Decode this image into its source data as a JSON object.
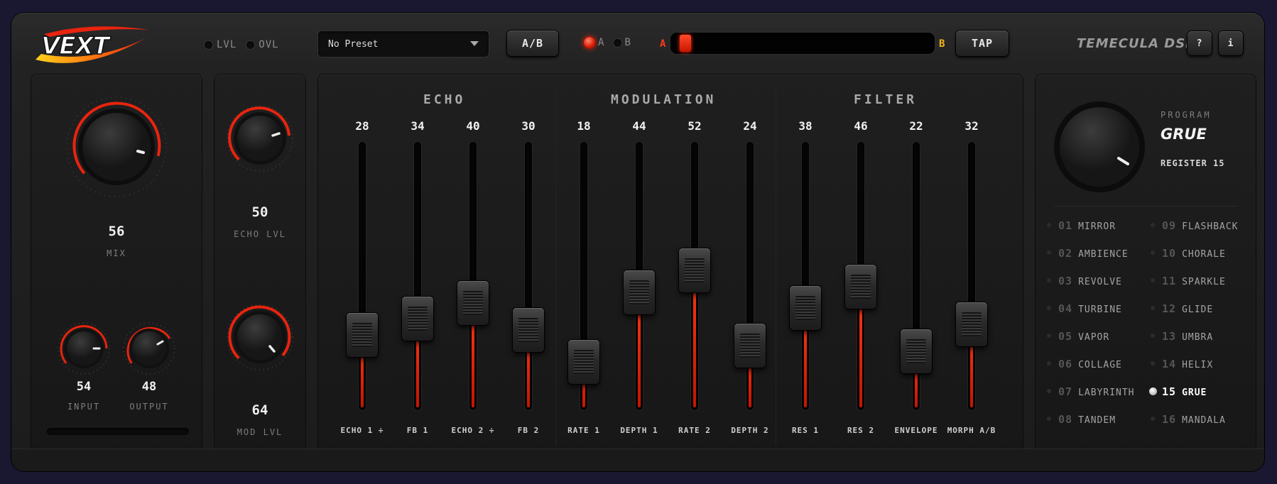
{
  "header": {
    "meter_lvl": "LVL",
    "meter_ovl": "OVL",
    "preset": "No Preset",
    "ab_button": "A/B",
    "ab_a": "A",
    "ab_b": "B",
    "morph_a": "A",
    "morph_b": "B",
    "morph_position": 0.02,
    "tap_button": "TAP",
    "brand": "TEMECULA DSP",
    "help_button": "?",
    "info_button": "i",
    "logo_text": "VEXT"
  },
  "left_panel": {
    "mix_value": "56",
    "mix_label": "MIX",
    "input_value": "54",
    "input_label": "INPUT",
    "output_value": "48",
    "output_label": "OUTPUT"
  },
  "level_panel": {
    "echo_value": "50",
    "echo_label": "ECHO LVL",
    "mod_value": "64",
    "mod_label": "MOD LVL"
  },
  "sections": {
    "echo": "ECHO",
    "modulation": "MODULATION",
    "filter": "FILTER"
  },
  "faders": [
    {
      "label": "ECHO 1 ÷",
      "value": 28
    },
    {
      "label": "FB 1",
      "value": 34
    },
    {
      "label": "ECHO 2 ÷",
      "value": 40
    },
    {
      "label": "FB 2",
      "value": 30
    },
    {
      "label": "RATE 1",
      "value": 18
    },
    {
      "label": "DEPTH 1",
      "value": 44
    },
    {
      "label": "RATE 2",
      "value": 52
    },
    {
      "label": "DEPTH 2",
      "value": 24
    },
    {
      "label": "RES 1",
      "value": 38
    },
    {
      "label": "RES 2",
      "value": 46
    },
    {
      "label": "ENVELOPE",
      "value": 22
    },
    {
      "label": "MORPH A/B",
      "value": 32
    }
  ],
  "program": {
    "label": "PROGRAM",
    "name": "GRUE",
    "register": "REGISTER 15",
    "list": [
      {
        "num": "01",
        "name": "MIRROR"
      },
      {
        "num": "02",
        "name": "AMBIENCE"
      },
      {
        "num": "03",
        "name": "REVOLVE"
      },
      {
        "num": "04",
        "name": "TURBINE"
      },
      {
        "num": "05",
        "name": "VAPOR"
      },
      {
        "num": "06",
        "name": "COLLAGE"
      },
      {
        "num": "07",
        "name": "LABYRINTH"
      },
      {
        "num": "08",
        "name": "TANDEM"
      },
      {
        "num": "09",
        "name": "FLASHBACK"
      },
      {
        "num": "10",
        "name": "CHORALE"
      },
      {
        "num": "11",
        "name": "SPARKLE"
      },
      {
        "num": "12",
        "name": "GLIDE"
      },
      {
        "num": "13",
        "name": "UMBRA"
      },
      {
        "num": "14",
        "name": "HELIX"
      },
      {
        "num": "15",
        "name": "GRUE"
      },
      {
        "num": "16",
        "name": "MANDALA"
      }
    ],
    "selected": "15"
  },
  "colors": {
    "accent": "#e8240e",
    "morph_b": "#f2b418",
    "panel": "#1b1b1b"
  }
}
